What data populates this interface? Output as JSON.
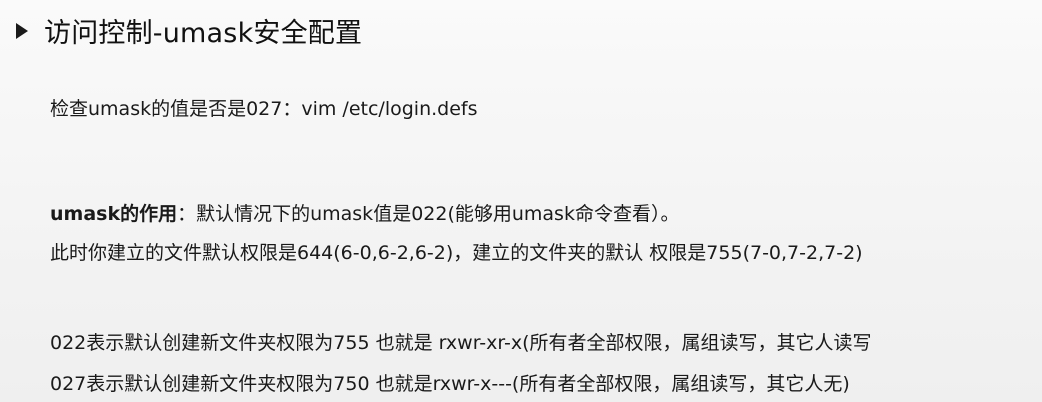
{
  "title": "访问控制-umask安全配置",
  "check_line": "检查umask的值是否是027：vim /etc/login.defs",
  "purpose": {
    "label": "umask的作用",
    "text": "：默认情况下的umask值是022(能够用umask命令查看）。"
  },
  "permission_line": "此时你建立的文件默认权限是644(6-0,6-2,6-2)，建立的文件夹的默认 权限是755(7-0,7-2,7-2)",
  "umask_022_line": "022表示默认创建新文件夹权限为755 也就是 rxwr-xr-x(所有者全部权限，属组读写，其它人读写",
  "umask_027_line": "027表示默认创建新文件夹权限为750 也就是rxwr-x---(所有者全部权限，属组读写，其它人无)"
}
